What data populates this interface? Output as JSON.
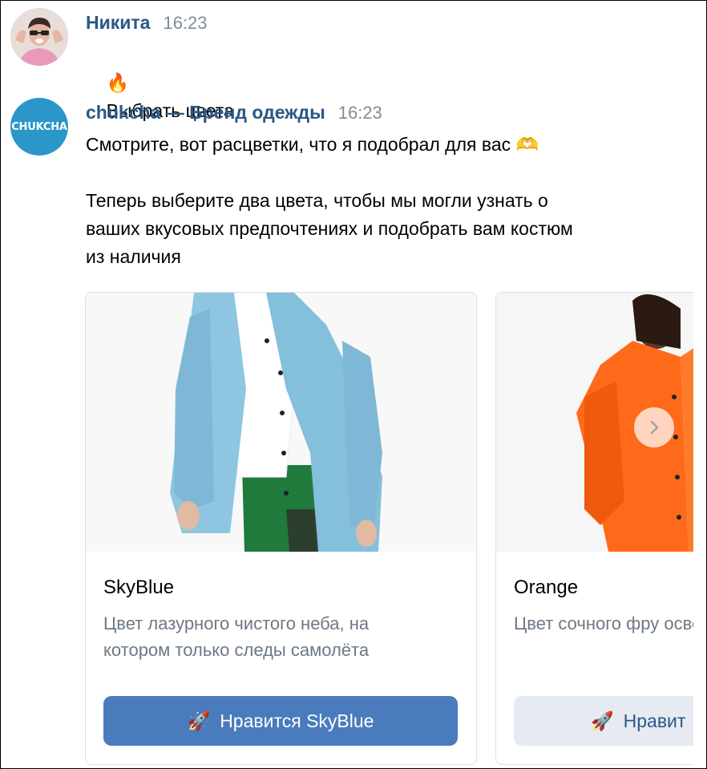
{
  "messages": [
    {
      "author": "Никита",
      "time": "16:23",
      "emoji": "🔥",
      "text": "Выбрать цвета"
    },
    {
      "author": "chukcha — Бренд одежды",
      "time": "16:23",
      "avatar_logo": "CHUKCHA",
      "text": "Смотрите, вот расцветки, что я подобрал для вас 🫶\n\nТеперь выберите два цвета, чтобы мы могли узнать о\nваших вкусовых предпочтениях и подобрать вам костюм\nиз наличия"
    }
  ],
  "carousel": {
    "cards": [
      {
        "title": "SkyBlue",
        "description": "Цвет лазурного чистого неба, на\nкотором только следы самолёта",
        "button_emoji": "🚀",
        "button_label": "Нравится SkyBlue",
        "image_color": "#8ec6e2"
      },
      {
        "title": "Orange",
        "description": "Цвет сочного фру\nосвежающего в зн",
        "button_emoji": "🚀",
        "button_label": "Нравит",
        "image_color": "#ff6a1a"
      }
    ],
    "next_icon": "chevron-right-icon"
  },
  "colors": {
    "author": "#2a5885",
    "time": "#818c99",
    "primary_button": "#4a7bbd",
    "secondary_button": "#e5ebf1",
    "brand_avatar": "#2b96c9"
  }
}
